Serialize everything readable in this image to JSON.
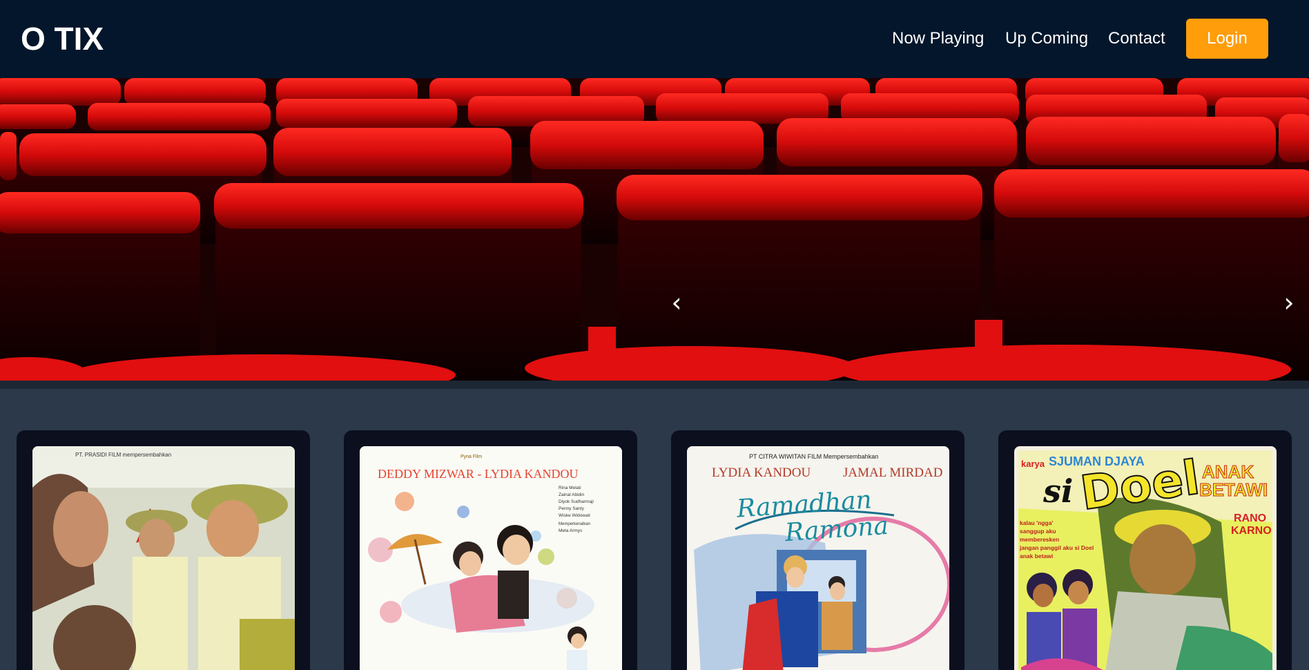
{
  "header": {
    "brand": "O TIX",
    "nav": [
      "Now Playing",
      "Up Coming",
      "Contact"
    ],
    "login_label": "Login",
    "colors": {
      "bar": "#03162b",
      "accent": "#ff9d0a"
    }
  },
  "carousel": {
    "prev_icon": "‹",
    "next_icon": "›"
  },
  "movies": [
    {
      "poster_credit": "PT. PRASIDI FILM mempersembahkan"
    },
    {
      "studio": "Pyna Film",
      "cast": "DEDDY MIZWAR - LYDIA KANDOU",
      "credits": [
        "Rina Melati",
        "Zainal Abidin",
        "Diyok Sudharmaji",
        "Penny Santy",
        "Wiske Widowati"
      ],
      "featuring_label": "Memperkenalkan",
      "featuring": "Meta Armys"
    },
    {
      "presenter": "PT CITRA WIWITAN FILM Mempersembahkan",
      "lead_female": "LYDIA KANDOU",
      "lead_male": "JAMAL MIRDAD",
      "title_line1": "Ramadhan",
      "title_line2": "Ramona"
    },
    {
      "karya_label": "karya",
      "director": "SJUMAN DJAYA",
      "title_si": "si",
      "title_main": "Doel",
      "subtitle_1": "ANAK",
      "subtitle_2": "BETAWI",
      "star_1": "RANO",
      "star_2": "KARNO",
      "tagline": [
        "kalau 'ngga'",
        "sanggup aku",
        "memberesken",
        "jangan panggil aku si Doel",
        "anak betawi"
      ]
    }
  ]
}
